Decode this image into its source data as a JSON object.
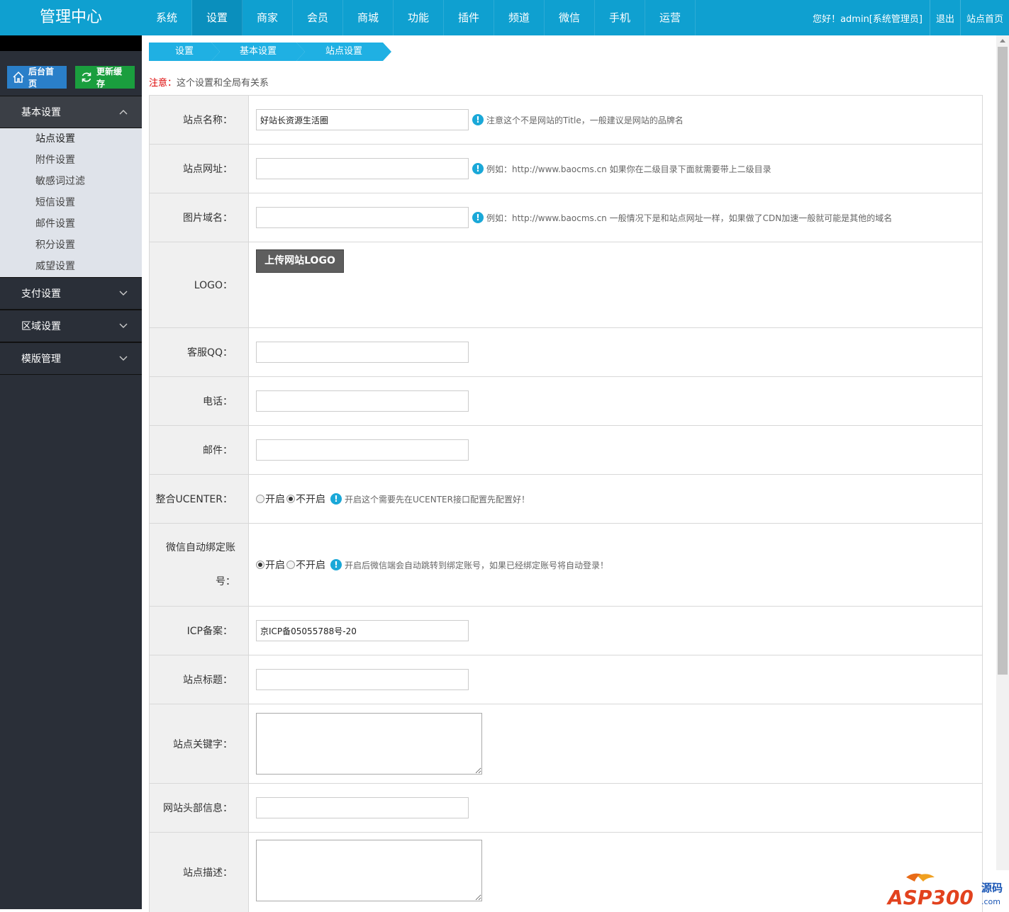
{
  "header": {
    "title": "管理中心",
    "tabs": [
      "系统",
      "设置",
      "商家",
      "会员",
      "商城",
      "功能",
      "插件",
      "频道",
      "微信",
      "手机",
      "运营"
    ],
    "active_tab": "设置",
    "greeting": "您好！admin[系统管理员]",
    "logout": "退出",
    "site_home": "站点首页"
  },
  "sidebar": {
    "home_button": "后台首页",
    "refresh_button": "更新缓存",
    "sections": [
      {
        "label": "基本设置",
        "items": [
          "站点设置",
          "附件设置",
          "敏感词过滤",
          "短信设置",
          "邮件设置",
          "积分设置",
          "威望设置"
        ]
      },
      {
        "label": "支付设置"
      },
      {
        "label": "区域设置"
      },
      {
        "label": "模版管理"
      }
    ]
  },
  "breadcrumb": [
    "设置",
    "基本设置",
    "站点设置"
  ],
  "notice": {
    "prefix": "注意：",
    "text": "这个设置和全局有关系"
  },
  "form": {
    "site_name": {
      "label": "站点名称：",
      "value": "好站长资源生活圈",
      "tip": "注意这个不是网站的Title，一般建议是网站的品牌名"
    },
    "site_url": {
      "label": "站点网址：",
      "value": "",
      "tip": "例如：http://www.baocms.cn 如果你在二级目录下面就需要带上二级目录"
    },
    "img_domain": {
      "label": "图片域名：",
      "value": "",
      "tip": "例如：http://www.baocms.cn 一般情况下是和站点网址一样，如果做了CDN加速一般就可能是其他的域名"
    },
    "logo": {
      "label": "LOGO：",
      "button": "上传网站LOGO"
    },
    "qq": {
      "label": "客服QQ：",
      "value": ""
    },
    "phone": {
      "label": "电话：",
      "value": ""
    },
    "email": {
      "label": "邮件：",
      "value": ""
    },
    "ucenter": {
      "label": "整合UCENTER：",
      "opt_on": "开启",
      "opt_off": "不开启",
      "selected": "不开启",
      "tip": "开启这个需要先在UCENTER接口配置先配置好！"
    },
    "wechat_bind": {
      "label_line1": "微信自动绑定账",
      "label_line2": "号：",
      "opt_on": "开启",
      "opt_off": "不开启",
      "selected": "开启",
      "tip": "开启后微信端会自动跳转到绑定账号，如果已经绑定账号将自动登录！"
    },
    "icp": {
      "label": "ICP备案：",
      "value": "京ICP备05055788号-20"
    },
    "site_title": {
      "label": "站点标题：",
      "value": ""
    },
    "keywords": {
      "label": "站点关键字：",
      "value": ""
    },
    "head_info": {
      "label": "网站头部信息：",
      "value": ""
    },
    "description": {
      "label": "站点描述：",
      "value": ""
    }
  },
  "watermark": {
    "brand": "ASP300",
    "suffix": "源码",
    "domain": ".com"
  },
  "colors": {
    "header": "#0fa0d0",
    "sidebar": "#2a2f38",
    "crumb": "#1fb0e3",
    "tip_icon": "#1aa8d8"
  }
}
